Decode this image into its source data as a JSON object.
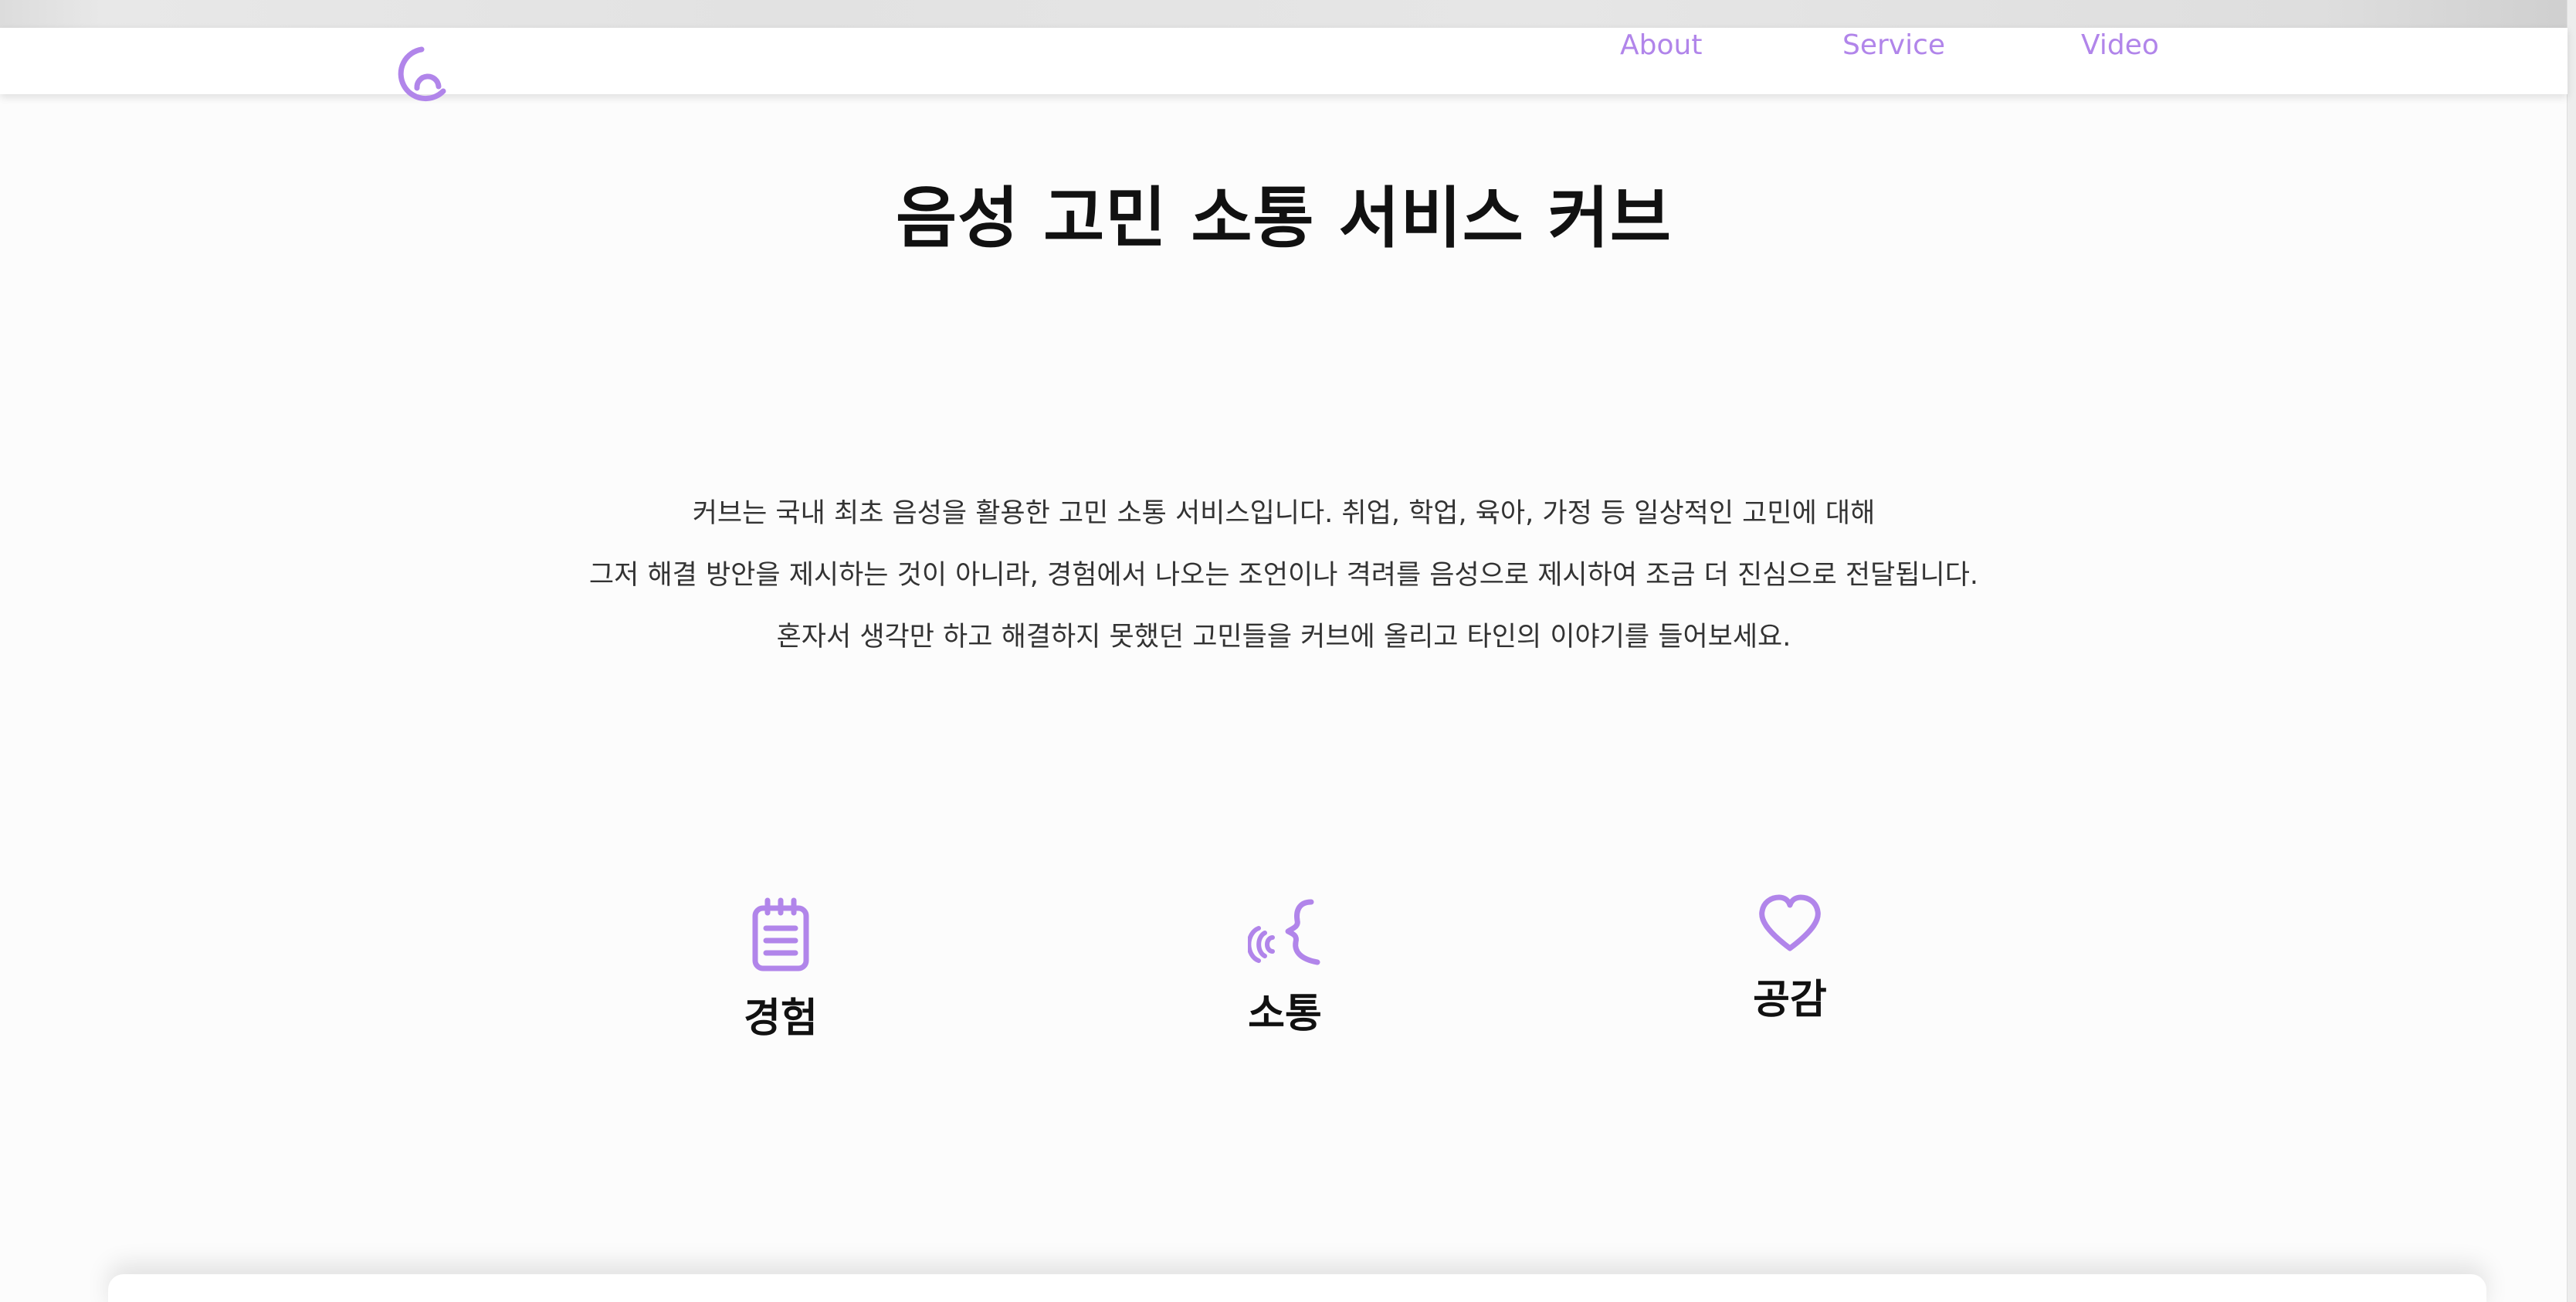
{
  "header": {
    "logo_icon": "kerb-logo-icon",
    "nav": [
      {
        "label": "About"
      },
      {
        "label": "Service"
      },
      {
        "label": "Video"
      }
    ]
  },
  "hero": {
    "title": "음성 고민 소통 서비스 커브",
    "description": [
      "커브는 국내 최초 음성을 활용한 고민 소통 서비스입니다. 취업, 학업, 육아, 가정 등 일상적인 고민에 대해",
      "그저 해결 방안을 제시하는 것이 아니라, 경험에서 나오는 조언이나 격려를 음성으로 제시하여 조금 더 진심으로 전달됩니다.",
      "혼자서 생각만 하고 해결하지 못했던 고민들을 커브에 올리고 타인의 이야기를 들어보세요."
    ]
  },
  "features": [
    {
      "label": "경험",
      "icon": "notepad-icon"
    },
    {
      "label": "소통",
      "icon": "voice-icon"
    },
    {
      "label": "공감",
      "icon": "heart-icon"
    }
  ],
  "colors": {
    "accent": "#b185ea",
    "text": "#111111",
    "background": "#fcfcfc"
  }
}
